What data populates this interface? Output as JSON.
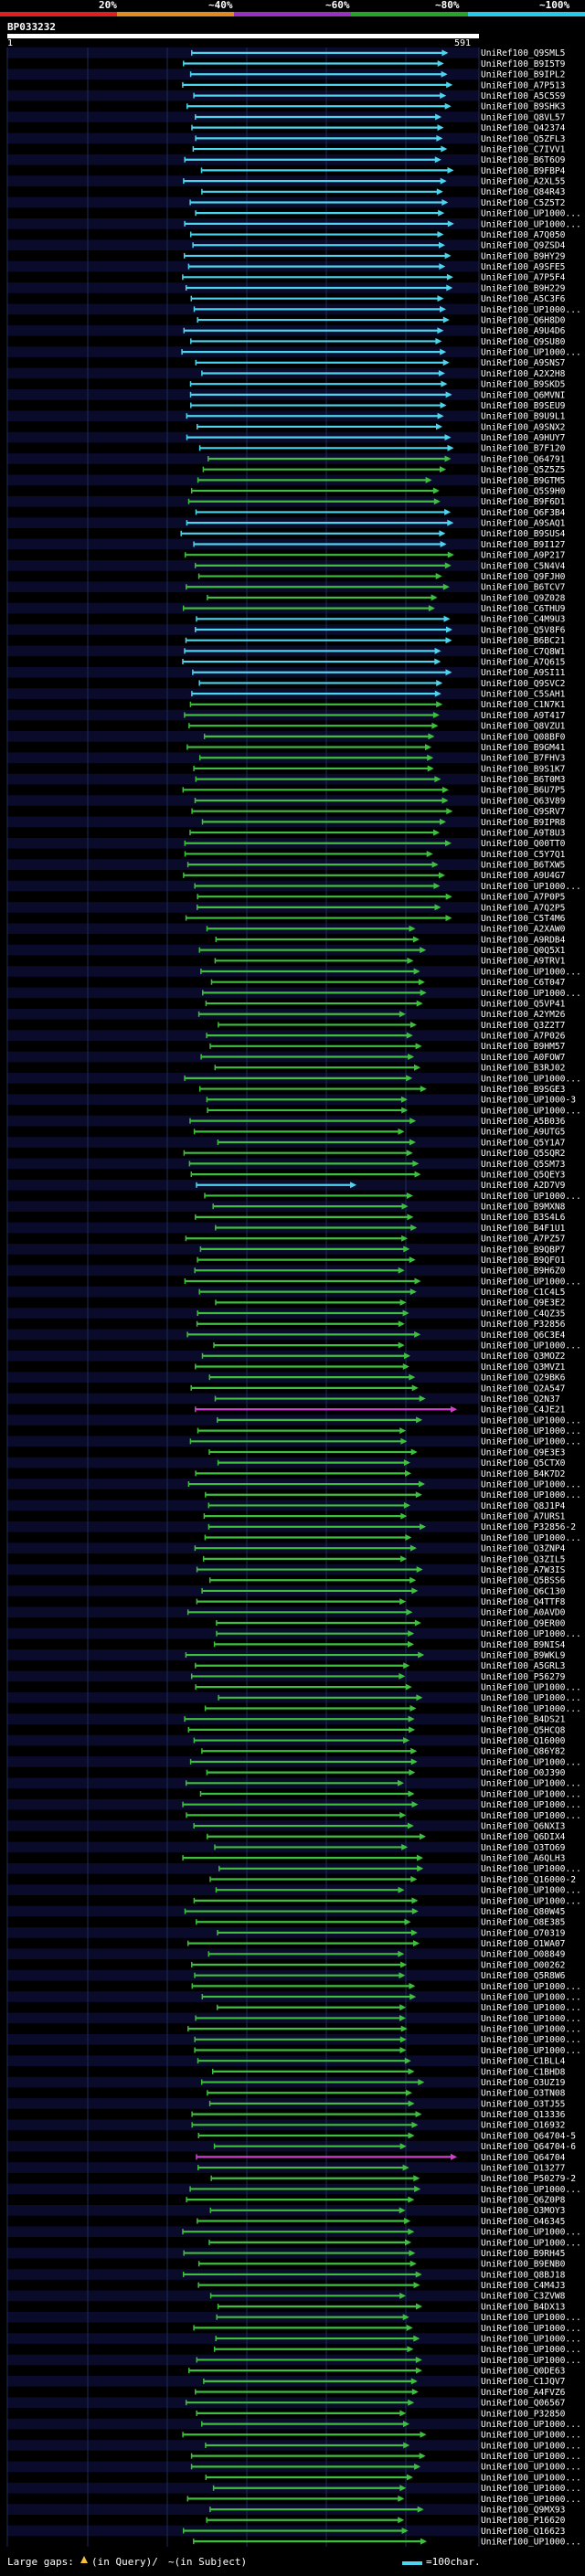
{
  "header": {
    "query_id": "BP033232",
    "percent_labels": [
      "20%",
      "~40%",
      "~60%",
      "~80%",
      "~100%"
    ],
    "color_bands": [
      "#e02020",
      "#e08a20",
      "#9a30c0",
      "#27a327",
      "#28c8e8"
    ],
    "scale_start": "1",
    "scale_end": "591"
  },
  "colors": {
    "cyan": "#4dd4ee",
    "green": "#3fbf3f",
    "magenta": "#d040d0",
    "blue_band": "#0a0a2a",
    "grid": "#1f2a55"
  },
  "hits": [
    "UniRef100_Q9SML5",
    "UniRef100_B9I5T9",
    "UniRef100_B9IPL2",
    "UniRef100_A7P513",
    "UniRef100_A5C5S9",
    "UniRef100_B9SHK3",
    "UniRef100_Q8VL57",
    "UniRef100_Q42374",
    "UniRef100_Q5ZFL3",
    "UniRef100_C7IVV1",
    "UniRef100_B6T6O9",
    "UniRef100_B9FBP4",
    "UniRef100_A2XL55",
    "UniRef100_Q84R43",
    "UniRef100_C5Z5T2",
    "UniRef100_UP1000...",
    "UniRef100_UP1000...",
    "UniRef100_A7Q050",
    "UniRef100_Q9ZSD4",
    "UniRef100_B9HY29",
    "UniRef100_A9SFE5",
    "UniRef100_A7P5F4",
    "UniRef100_B9H229",
    "UniRef100_A5C3F6",
    "UniRef100_UP1000...",
    "UniRef100_Q6H8D0",
    "UniRef100_A9U4D6",
    "UniRef100_Q9SU80",
    "UniRef100_UP1000...",
    "UniRef100_A9SNS7",
    "UniRef100_A2X2H8",
    "UniRef100_B9SKD5",
    "UniRef100_Q6MVNI",
    "UniRef100_B9SEU9",
    "UniRef100_B9U9L1",
    "UniRef100_A9SNX2",
    "UniRef100_A9HUY7",
    "UniRef100_B7F120",
    "UniRef100_Q64791",
    "UniRef100_Q5Z5Z5",
    "UniRef100_B9GTM5",
    "UniRef100_Q5S9H0",
    "UniRef100_B9F6D1",
    "UniRef100_Q6F3B4",
    "UniRef100_A9SAQ1",
    "UniRef100_B9SUS4",
    "UniRef100_B9I127",
    "UniRef100_A9P217",
    "UniRef100_C5N4V4",
    "UniRef100_Q9FJH0",
    "UniRef100_B6TCV7",
    "UniRef100_Q9Z028",
    "UniRef100_C6THU9",
    "UniRef100_C4M9U3",
    "UniRef100_Q5V8F6",
    "UniRef100_B6BC21",
    "UniRef100_C7Q8W1",
    "UniRef100_A7Q615",
    "UniRef100_A9SI11",
    "UniRef100_Q9SVC2",
    "UniRef100_C5SAH1",
    "UniRef100_C1N7K1",
    "UniRef100_A9T417",
    "UniRef100_Q8VZU1",
    "UniRef100_Q08BF0",
    "UniRef100_B9GM41",
    "UniRef100_B7FHV3",
    "UniRef100_B9S1K7",
    "UniRef100_B6T0M3",
    "UniRef100_B6U7P5",
    "UniRef100_Q63V89",
    "UniRef100_Q9SRV7",
    "UniRef100_B9IPR8",
    "UniRef100_A9T8U3",
    "UniRef100_Q00TT0",
    "UniRef100_C5Y7Q1",
    "UniRef100_B6TXW5",
    "UniRef100_A9U4G7",
    "UniRef100_UP1000...",
    "UniRef100_A7P0P5",
    "UniRef100_A7Q2P5",
    "UniRef100_C5T4M6",
    "UniRef100_A2XAW0",
    "UniRef100_A9RDB4",
    "UniRef100_Q0Q5X1",
    "UniRef100_A9TRV1",
    "UniRef100_UP1000...",
    "UniRef100_C6T047",
    "UniRef100_UP1000...",
    "UniRef100_Q5VP41",
    "UniRef100_A2YM26",
    "UniRef100_Q3Z2T7",
    "UniRef100_A7P026",
    "UniRef100_B9HM57",
    "UniRef100_A0FOW7",
    "UniRef100_B3RJ02",
    "UniRef100_UP1000...",
    "UniRef100_B9SGE3",
    "UniRef100_UP1000-3",
    "UniRef100_UP1000...",
    "UniRef100_A5B036",
    "UniRef100_A9UTG5",
    "UniRef100_Q5Y1A7",
    "UniRef100_Q5SQR2",
    "UniRef100_Q5SM73",
    "UniRef100_Q5QEY3",
    "UniRef100_A2D7V9",
    "UniRef100_UP1000...",
    "UniRef100_B9MXN8",
    "UniRef100_B3S4L6",
    "UniRef100_B4F1U1",
    "UniRef100_A7PZ57",
    "UniRef100_B9QBP7",
    "UniRef100_B9QFO1",
    "UniRef100_B9H6Z0",
    "UniRef100_UP1000...",
    "UniRef100_C1C4L5",
    "UniRef100_Q9E3E2",
    "UniRef100_C4QZ35",
    "UniRef100_P32856",
    "UniRef100_Q6C3E4",
    "UniRef100_UP1000...",
    "UniRef100_Q3MOZ2",
    "UniRef100_Q3MVZ1",
    "UniRef100_Q29BK6",
    "UniRef100_Q2A547",
    "UniRef100_Q2N37",
    "UniRef100_C4JE21",
    "UniRef100_UP1000...",
    "UniRef100_UP1000...",
    "UniRef100_UP1000...",
    "UniRef100_Q9E3E3",
    "UniRef100_Q5CTX0",
    "UniRef100_B4K7D2",
    "UniRef100_UP1000...",
    "UniRef100_UP1000...",
    "UniRef100_Q8J1P4",
    "UniRef100_A7URS1",
    "UniRef100_P32856-2",
    "UniRef100_UP1000...",
    "UniRef100_Q3ZNP4",
    "UniRef100_Q3ZIL5",
    "UniRef100_A7W3IS",
    "UniRef100_Q5BSS6",
    "UniRef100_Q6C130",
    "UniRef100_Q4TTF8",
    "UniRef100_A0AVD0",
    "UniRef100_Q9ER00",
    "UniRef100_UP1000...",
    "UniRef100_B9NIS4",
    "UniRef100_B9WKL9",
    "UniRef100_A5GRL3",
    "UniRef100_P56279",
    "UniRef100_UP1000...",
    "UniRef100_UP1000...",
    "UniRef100_UP1000...",
    "UniRef100_B4DS21",
    "UniRef100_Q5HCQ8",
    "UniRef100_Q16000",
    "UniRef100_Q86Y82",
    "UniRef100_UP1000...",
    "UniRef100_O0J390",
    "UniRef100_UP1000...",
    "UniRef100_UP1000...",
    "UniRef100_UP1000...",
    "UniRef100_UP1000...",
    "UniRef100_Q6NXI3",
    "UniRef100_Q6DIX4",
    "UniRef100_O3TO69",
    "UniRef100_A6QLH3",
    "UniRef100_UP1000...",
    "UniRef100_Q16000-2",
    "UniRef100_UP1000...",
    "UniRef100_UP1000...",
    "UniRef100_Q80W45",
    "UniRef100_O8E385",
    "UniRef100_O70319",
    "UniRef100_O1WA07",
    "UniRef100_O08849",
    "UniRef100_O00262",
    "UniRef100_Q5R8W6",
    "UniRef100_UP1000...",
    "UniRef100_UP1000...",
    "UniRef100_UP1000...",
    "UniRef100_UP1000...",
    "UniRef100_UP1000...",
    "UniRef100_UP1000...",
    "UniRef100_UP1000...",
    "UniRef100_C1BLL4",
    "UniRef100_C1BHD8",
    "UniRef100_O3UZ19",
    "UniRef100_O3TN08",
    "UniRef100_O3TJ55",
    "UniRef100_Q13336",
    "UniRef100_O16932",
    "UniRef100_Q64704-5",
    "UniRef100_Q64704-6",
    "UniRef100_Q64704",
    "UniRef100_O13277",
    "UniRef100_P50279-2",
    "UniRef100_UP1000...",
    "UniRef100_Q6Z0P8",
    "UniRef100_O3MOY3",
    "UniRef100_O46345",
    "UniRef100_UP1000...",
    "UniRef100_UP1000...",
    "UniRef100_B9RH45",
    "UniRef100_B9ENB0",
    "UniRef100_Q8BJ18",
    "UniRef100_C4M4J3",
    "UniRef100_C3ZVW8",
    "UniRef100_B4DX13",
    "UniRef100_UP1000...",
    "UniRef100_UP1000...",
    "UniRef100_UP1000...",
    "UniRef100_UP1000...",
    "UniRef100_UP1000...",
    "UniRef100_Q0DE63",
    "UniRef100_C1JQV7",
    "UniRef100_A4FVZ6",
    "UniRef100_Q06567",
    "UniRef100_P32850",
    "UniRef100_UP1000...",
    "UniRef100_UP1000...",
    "UniRef100_UP1000...",
    "UniRef100_UP1000...",
    "UniRef100_UP1000...",
    "UniRef100_UP1000...",
    "UniRef100_UP1000...",
    "UniRef100_UP1000...",
    "UniRef100_Q9MX93",
    "UniRef100_P16620",
    "UniRef100_Q16623",
    "UniRef100_UP1000..."
  ],
  "legend": {
    "text": "Large gaps:",
    "query_text": "(in Query)/",
    "subject_text": "~(in Subject)",
    "scale_text": "=100char."
  }
}
